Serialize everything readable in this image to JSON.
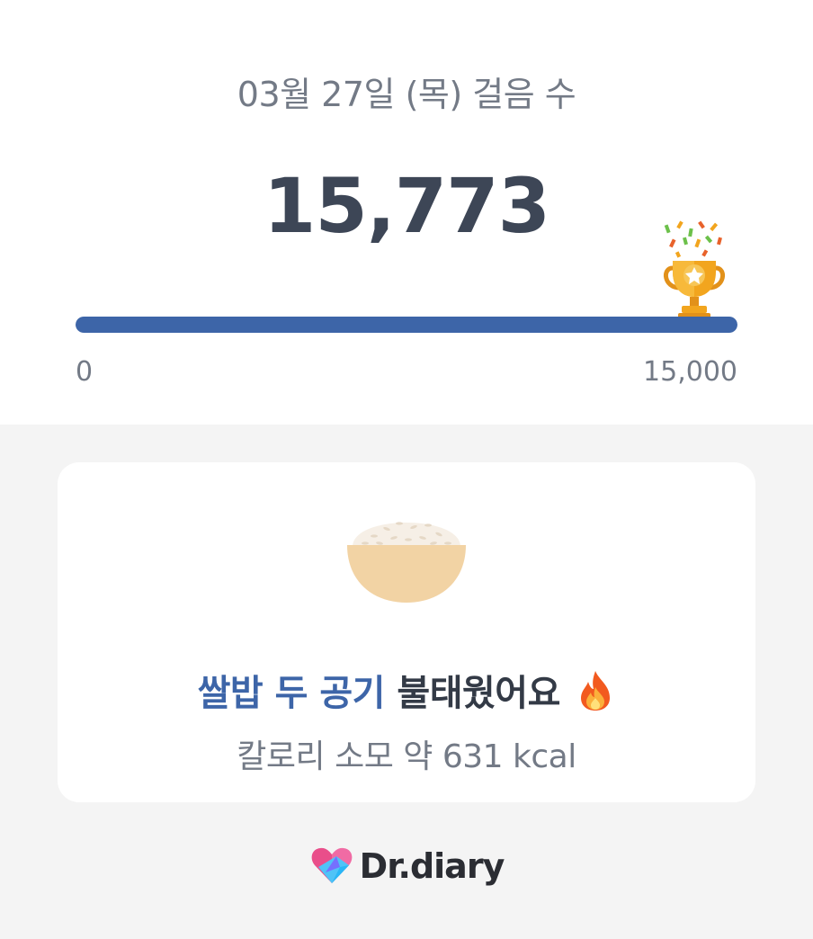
{
  "steps": {
    "date_title": "03월 27일 (목) 걸음 수",
    "count": "15,773",
    "goal_progress": 1.0,
    "scale_min": "0",
    "scale_max": "15,000"
  },
  "card": {
    "highlight": "쌀밥 두 공기",
    "headline_rest": " 불태웠어요",
    "calorie_text": "칼로리 소모 약 631 kcal"
  },
  "brand": {
    "name": "Dr.diary"
  },
  "icons": [
    "trophy-icon",
    "rice-bowl-icon",
    "fire-icon",
    "brand-heart-icon"
  ],
  "colors": {
    "accent": "#3d65a8",
    "text_dark": "#3d4656",
    "text_muted": "#737a86",
    "trophy": "#f2a51e"
  }
}
